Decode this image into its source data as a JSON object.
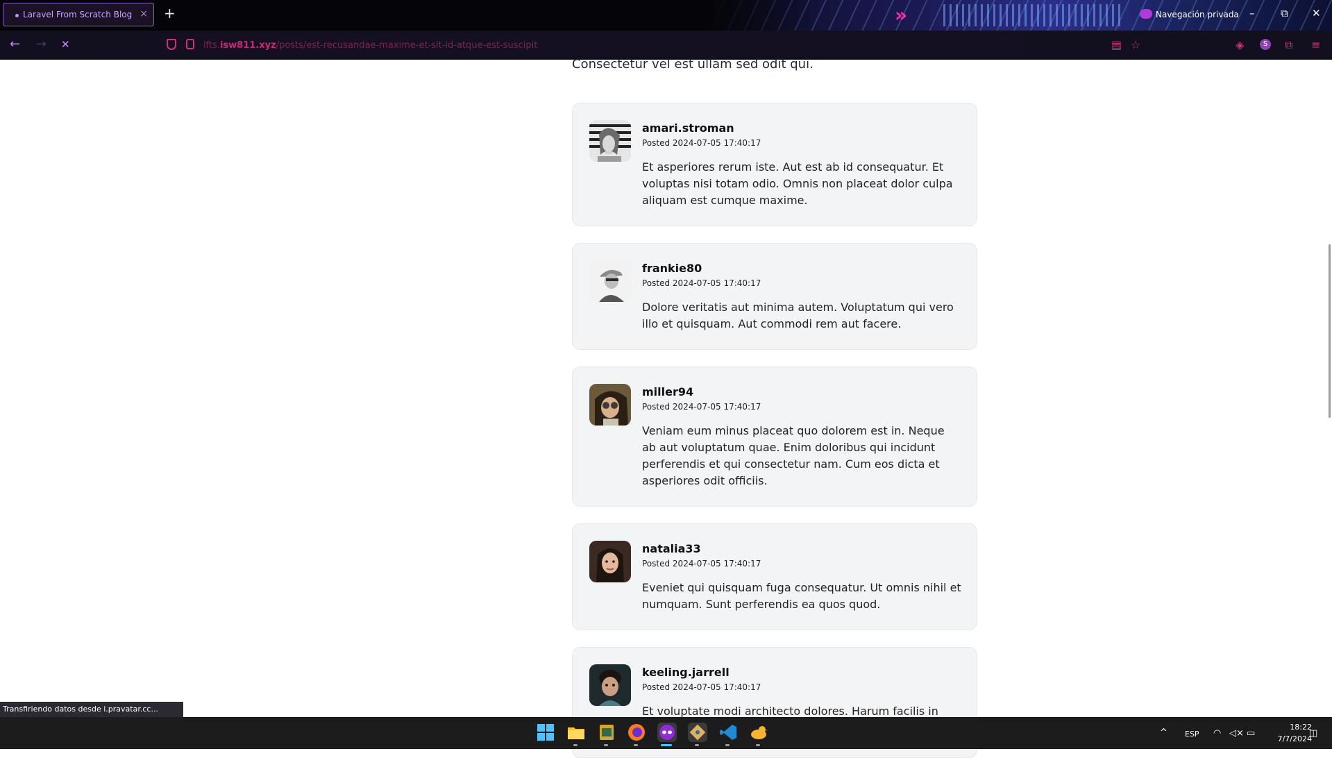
{
  "browser": {
    "tab_title": "Laravel From Scratch Blog",
    "tab_close": "×",
    "new_tab": "+",
    "private_label": "Navegación privada",
    "window_minimize": "–",
    "window_restore": "⧉",
    "window_close": "✕",
    "back": "←",
    "forward": "→",
    "stop": "✕",
    "url_prefix": "lfts.",
    "url_domain": "isw811.xyz",
    "url_path": "/posts/est-recusandae-maxime-et-sit-id-atque-est-suscipit",
    "icons": {
      "reader": "reader-view-icon",
      "bookmark": "bookmark-star-icon",
      "pocket": "pocket-icon",
      "account": "account-icon",
      "extensions": "extensions-icon",
      "menu": "hamburger-menu-icon"
    },
    "status_text": "Transfiriendo datos desde i.pravatar.cc..."
  },
  "post": {
    "intro_text": "Consectetur vel est ullam sed odit qui."
  },
  "comments": [
    {
      "username": "amari.stroman",
      "posted": "Posted 2024-07-05 17:40:17",
      "body": "Et asperiores rerum iste. Aut est ab id consequatur. Et voluptas nisi totam odio. Omnis non placeat dolor culpa aliquam est cumque maxime."
    },
    {
      "username": "frankie80",
      "posted": "Posted 2024-07-05 17:40:17",
      "body": "Dolore veritatis aut minima autem. Voluptatum qui vero illo et quisquam. Aut commodi rem aut facere."
    },
    {
      "username": "miller94",
      "posted": "Posted 2024-07-05 17:40:17",
      "body": "Veniam eum minus placeat quo dolorem est in. Neque ab aut voluptatum quae. Enim doloribus qui incidunt perferendis et qui consectetur nam. Cum eos dicta et asperiores odit officiis."
    },
    {
      "username": "natalia33",
      "posted": "Posted 2024-07-05 17:40:17",
      "body": "Eveniet qui quisquam fuga consequatur. Ut omnis nihil et numquam. Sunt perferendis ea quos quod."
    },
    {
      "username": "keeling.jarrell",
      "posted": "Posted 2024-07-05 17:40:17",
      "body": "Et voluptate modi architecto dolores. Harum facilis in itaque"
    }
  ],
  "taskbar": {
    "apps": [
      "windows-start-icon",
      "file-explorer-icon",
      "notepad-icon",
      "firefox-icon",
      "firefox-private-icon",
      "git-icon",
      "vscode-icon",
      "terminal-duck-icon"
    ],
    "language": "ESP",
    "time": "18:22",
    "date": "7/7/2024"
  },
  "colors": {
    "card_bg": "#f3f4f6",
    "url_accent": "#c92a76",
    "tab_accent": "#c9a6ff"
  }
}
